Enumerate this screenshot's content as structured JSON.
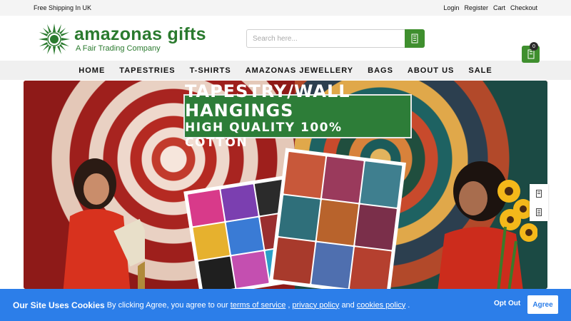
{
  "topbar": {
    "promo": "Free Shipping In UK",
    "links": [
      "Login",
      "Register",
      "Cart",
      "Checkout"
    ]
  },
  "brand": {
    "name": "amazonas gifts",
    "tagline": "A Fair Trading Company",
    "color": "#2a7a2e"
  },
  "search": {
    "placeholder": "Search here...",
    "button_icon": "search-icon"
  },
  "cart": {
    "icon": "cart-icon",
    "count": "0"
  },
  "nav": {
    "items": [
      "HOME",
      "TAPESTRIES",
      "T-SHIRTS",
      "AMAZONAS JEWELLERY",
      "BAGS",
      "ABOUT US",
      "SALE"
    ]
  },
  "hero": {
    "title": "TAPESTRY/WALL HANGINGS",
    "subtitle": "HIGH QUALITY 100% COTTON"
  },
  "side_icons": [
    "bookmark-icon",
    "document-icon"
  ],
  "cookie": {
    "heading": "Our Site Uses Cookies",
    "text": "By clicking Agree, you agree to our",
    "link_terms": "terms of service",
    "sep1": ",",
    "link_privacy": "privacy policy",
    "and": "and",
    "link_cookies": "cookies policy",
    "end": ".",
    "opt_out": "Opt Out",
    "agree": "Agree",
    "color": "#2c7ee9"
  }
}
